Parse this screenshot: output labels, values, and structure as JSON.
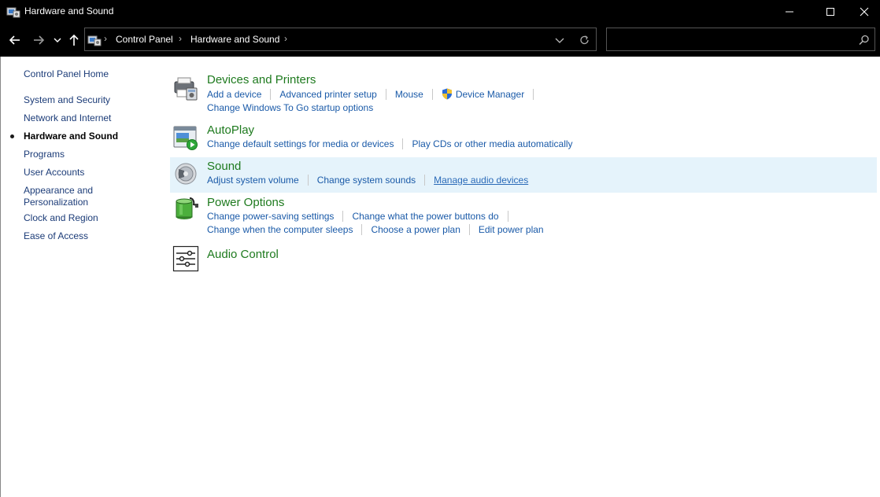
{
  "window": {
    "title": "Hardware and Sound"
  },
  "address": {
    "crumbs": [
      "Control Panel",
      "Hardware and Sound"
    ]
  },
  "search": {
    "placeholder": ""
  },
  "sidebar": {
    "home": "Control Panel Home",
    "items": [
      {
        "label": "System and Security"
      },
      {
        "label": "Network and Internet"
      },
      {
        "label": "Hardware and Sound"
      },
      {
        "label": "Programs"
      },
      {
        "label": "User Accounts"
      },
      {
        "label": "Appearance and",
        "label2": "Personalization"
      },
      {
        "label": "Clock and Region"
      },
      {
        "label": "Ease of Access"
      }
    ]
  },
  "categories": {
    "devices": {
      "title": "Devices and Printers",
      "links": [
        "Add a device",
        "Advanced printer setup",
        "Mouse",
        "Device Manager",
        "Change Windows To Go startup options"
      ]
    },
    "autoplay": {
      "title": "AutoPlay",
      "links": [
        "Change default settings for media or devices",
        "Play CDs or other media automatically"
      ]
    },
    "sound": {
      "title": "Sound",
      "links": [
        "Adjust system volume",
        "Change system sounds",
        "Manage audio devices"
      ]
    },
    "power": {
      "title": "Power Options",
      "links": [
        "Change power-saving settings",
        "Change what the power buttons do",
        "Change when the computer sleeps",
        "Choose a power plan",
        "Edit power plan"
      ]
    },
    "audio": {
      "title": "Audio Control"
    }
  },
  "colors": {
    "category_title": "#1e7a1e",
    "link": "#1a5aa8",
    "hover_background": "#e5f3fb",
    "titlebar": "#000000"
  }
}
